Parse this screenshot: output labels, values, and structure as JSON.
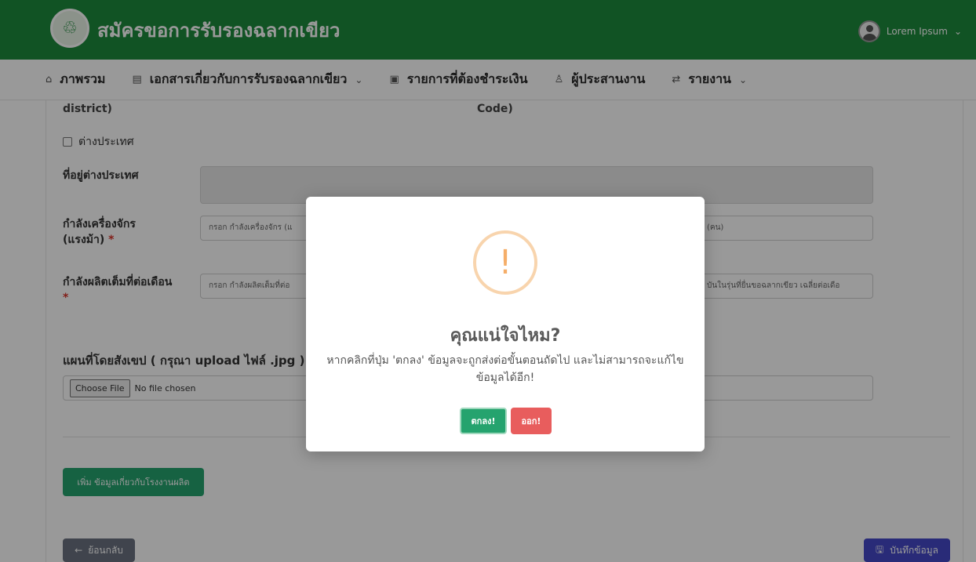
{
  "header": {
    "title": "สมัครขอการรับรองฉลากเขียว",
    "user_name": "Lorem Ipsum",
    "user_chevron": "⌄"
  },
  "nav": {
    "items": [
      {
        "label": "ภาพรวม",
        "icon": "home-icon",
        "glyph": "⌂"
      },
      {
        "label": "เอกสารเกี่ยวกับการรับรองฉลากเขียว",
        "icon": "document-icon",
        "glyph": "▤",
        "chevron": "⌄"
      },
      {
        "label": "รายการที่ต้องชำระเงิน",
        "icon": "payment-icon",
        "glyph": "▣"
      },
      {
        "label": "ผู้ประสานงาน",
        "icon": "user-icon",
        "glyph": "♙"
      },
      {
        "label": "รายงาน",
        "icon": "report-icon",
        "glyph": "⇄",
        "chevron": "⌄"
      }
    ]
  },
  "form": {
    "cutoff_left": "district)",
    "cutoff_middle": "Code)",
    "overseas_checkbox_label": "ต่างประเทศ",
    "overseas_address_label": "ที่อยู่ต่างประเทศ",
    "machine_power_label": "กำลังเครื่องจักร (แรงม้า)",
    "machine_power_placeholder": "กรอก กำลังเครื่องจักร (แ",
    "worker_placeholder": "(คน)",
    "monthly_capacity_label": "กำลังผลิตเต็มที่ต่อเดือน",
    "monthly_capacity_placeholder": "กรอก กำลังผลิตเต็มที่ต่อ",
    "current_capacity_placeholder": "บันในรุ่นที่ยื่นขอฉลากเขียว เฉลี่ยต่อเดือ",
    "required_mark": "*",
    "map_label": "แผนที่โดยสังเขป ( กรุณา upload ไฟล์ .jpg )",
    "file_button": "Choose File",
    "file_status": "No file chosen",
    "add_button": "เพิ่ม ข้อมูลเกี่ยวกับโรงงานผลิต",
    "back_button": "ย้อนกลับ",
    "back_icon": "←",
    "save_button": "บันทึกข้อมูล",
    "save_icon": "🖫"
  },
  "modal": {
    "icon": "!",
    "title": "คุณแน่ใจไหม?",
    "message": "หากคลิกที่ปุ่ม 'ตกลง' ข้อมูลจะถูกส่งต่อขั้นตอนถัดไป และไม่สามารถจะแก้ไขข้อมูลได้อีก!",
    "confirm_button": "ตกลง!",
    "cancel_button": "ออก!"
  },
  "colors": {
    "header": "#1d8a3c",
    "confirm": "#25a36e",
    "cancel": "#e85d5d",
    "save": "#4548c9",
    "warning": "#f5ae69"
  }
}
